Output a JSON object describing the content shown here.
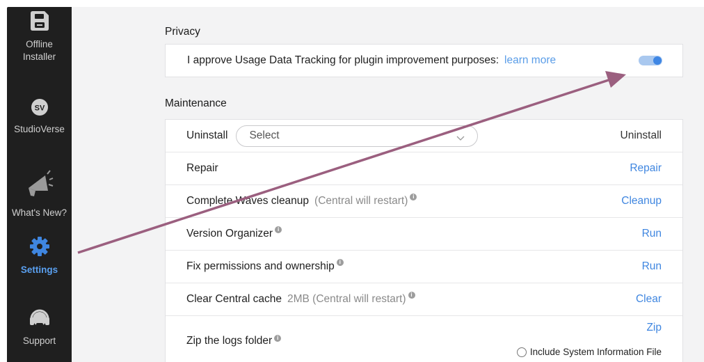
{
  "sidebar": {
    "items": [
      {
        "label": "Offline\nInstaller",
        "icon": "save-disk-icon"
      },
      {
        "label": "StudioVerse",
        "icon": "sv-badge-icon",
        "badge": "SV"
      },
      {
        "label": "What's New?",
        "icon": "megaphone-icon"
      },
      {
        "label": "Settings",
        "icon": "gear-icon",
        "active": true
      },
      {
        "label": "Support",
        "icon": "headset-icon"
      }
    ],
    "offline_line1": "Offline",
    "offline_line2": "Installer"
  },
  "privacy": {
    "title": "Privacy",
    "text": "I approve Usage Data Tracking for plugin improvement purposes:",
    "link": "learn more",
    "toggle_on": true
  },
  "maintenance": {
    "title": "Maintenance",
    "uninstall": {
      "label": "Uninstall",
      "select_value": "Select",
      "action": "Uninstall"
    },
    "repair": {
      "label": "Repair",
      "action": "Repair"
    },
    "cleanup": {
      "label": "Complete Waves cleanup",
      "note": "(Central will restart)",
      "action": "Cleanup"
    },
    "version": {
      "label": "Version Organizer",
      "action": "Run"
    },
    "permissions": {
      "label": "Fix permissions and ownership",
      "action": "Run"
    },
    "cache": {
      "label": "Clear Central cache",
      "note": "2MB (Central will restart)",
      "action": "Clear"
    },
    "zip": {
      "label": "Zip the logs folder",
      "action": "Zip",
      "checkbox_label": "Include System Information File"
    }
  },
  "colors": {
    "accent": "#3f86e0",
    "sidebar_bg": "#1f1f1f",
    "annotation_arrow": "#9b5f7f"
  }
}
